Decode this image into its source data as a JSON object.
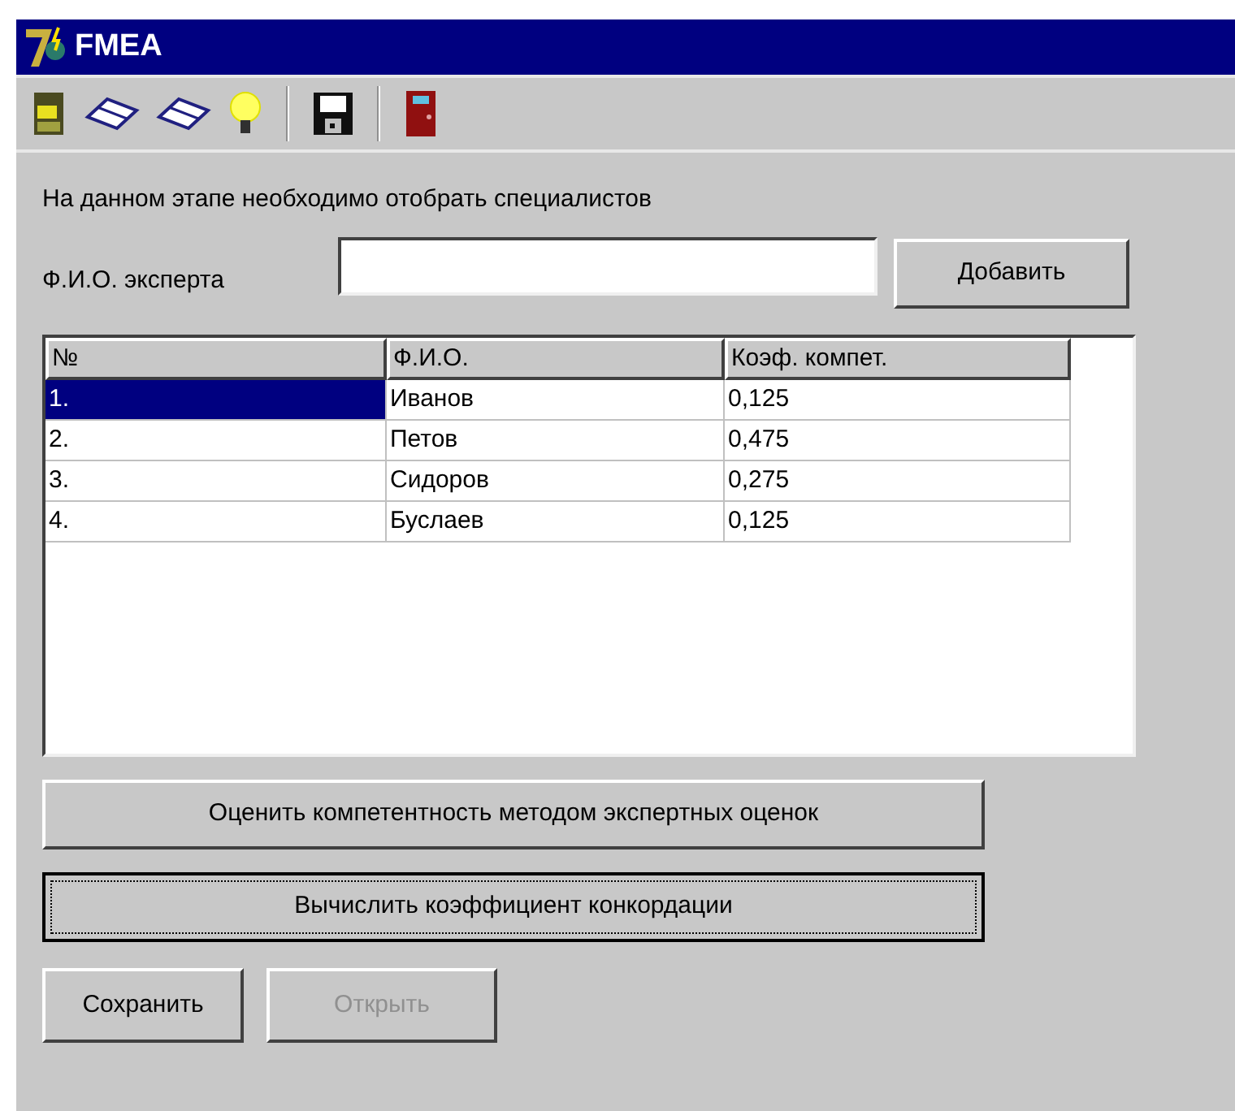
{
  "window": {
    "title": "FMEA"
  },
  "toolbar": [
    {
      "kind": "cabinet"
    },
    {
      "kind": "book"
    },
    {
      "kind": "book"
    },
    {
      "kind": "bulb"
    },
    {
      "kind": "separator"
    },
    {
      "kind": "save"
    },
    {
      "kind": "separator"
    },
    {
      "kind": "door"
    }
  ],
  "instruction": "На данном этапе необходимо отобрать специалистов",
  "expert_field": {
    "label": "Ф.И.О. эксперта"
  },
  "add_button": "Добавить",
  "table": {
    "columns": [
      "№",
      "Ф.И.О.",
      "Коэф. компет."
    ],
    "rows": [
      {
        "cells": [
          "1.",
          "Иванов",
          "0,125"
        ],
        "selected": true
      },
      {
        "cells": [
          "2.",
          "Петов",
          "0,475"
        ],
        "selected": false
      },
      {
        "cells": [
          "3.",
          "Сидоров",
          "0,275"
        ],
        "selected": false
      },
      {
        "cells": [
          "4.",
          "Буслаев",
          "0,125"
        ],
        "selected": false
      }
    ]
  },
  "action_buttons": [
    {
      "label": "Оценить компетентность методом экспертных оценок",
      "focused": false
    },
    {
      "label": "Вычислить коэффициент конкордации",
      "focused": true
    }
  ],
  "bottom_buttons": [
    {
      "label": "Сохранить",
      "disabled": false
    },
    {
      "label": "Открыть",
      "disabled": true
    }
  ]
}
